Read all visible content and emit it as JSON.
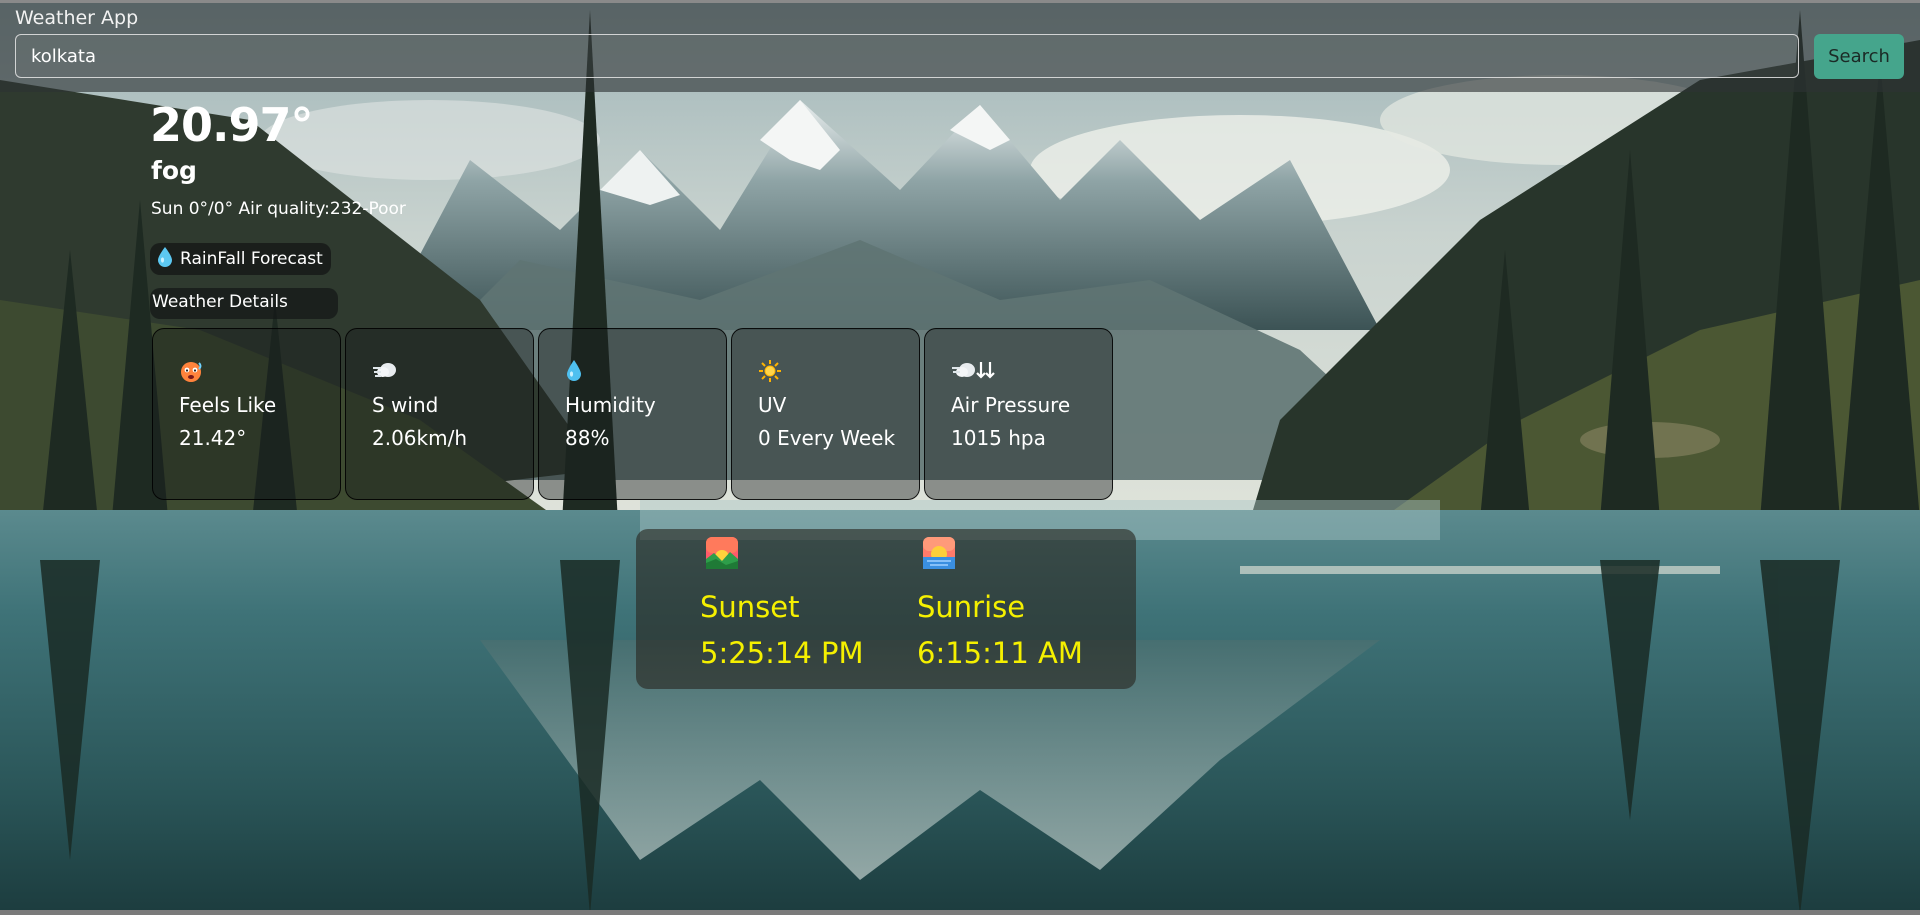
{
  "app": {
    "title": "Weather App"
  },
  "search": {
    "value": "kolkata",
    "button_label": "Search"
  },
  "current": {
    "temperature": "20.97°",
    "condition": "fog",
    "summary": "Sun 0°/0° Air quality:232-Poor"
  },
  "rainfall": {
    "label": "RainFall Forecast",
    "icon": "water-drop-icon"
  },
  "details": {
    "heading": "Weather Details",
    "cards": [
      {
        "title": "Feels Like",
        "value": "21.42°",
        "icon": "hot-face-icon"
      },
      {
        "title": "S wind",
        "value": "2.06km/h",
        "icon": "wind-icon"
      },
      {
        "title": "Humidity",
        "value": "88%",
        "icon": "water-drop-icon"
      },
      {
        "title": "UV",
        "value": "0 Every Week",
        "icon": "sun-icon"
      },
      {
        "title": "Air Pressure",
        "value": "1015 hpa",
        "icon": "pressure-icon"
      }
    ]
  },
  "sun": {
    "sunset": {
      "label": "Sunset",
      "time": "5:25:14 PM",
      "icon": "sunset-icon"
    },
    "sunrise": {
      "label": "Sunrise",
      "time": "6:15:11 AM",
      "icon": "sunrise-icon"
    }
  },
  "colors": {
    "accent": "#45a58c",
    "sun_text": "#f5f000"
  }
}
